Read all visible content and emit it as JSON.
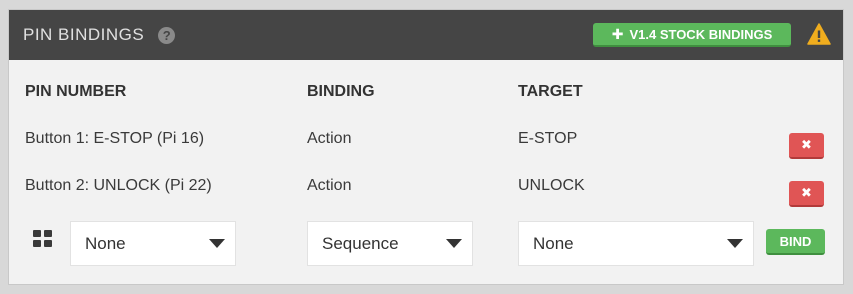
{
  "header": {
    "title": "PIN BINDINGS",
    "help_icon": "?",
    "stock_button_icon": "✚",
    "stock_button_label": "V1.4 STOCK BINDINGS",
    "warning_icon": "warning-triangle"
  },
  "table": {
    "columns": [
      "PIN NUMBER",
      "BINDING",
      "TARGET"
    ],
    "rows": [
      {
        "pin": "Button 1: E-STOP (Pi 16)",
        "binding": "Action",
        "target": "E-STOP",
        "delete_icon": "✖"
      },
      {
        "pin": "Button 2: UNLOCK (Pi 22)",
        "binding": "Action",
        "target": "UNLOCK",
        "delete_icon": "✖"
      }
    ]
  },
  "new_binding": {
    "pin_select": "None",
    "binding_select": "Sequence",
    "target_select": "None",
    "bind_label": "BIND"
  },
  "colors": {
    "header_bg": "#454545",
    "success": "#5cb85c",
    "danger": "#e05555",
    "warning": "#f0ad1e"
  }
}
